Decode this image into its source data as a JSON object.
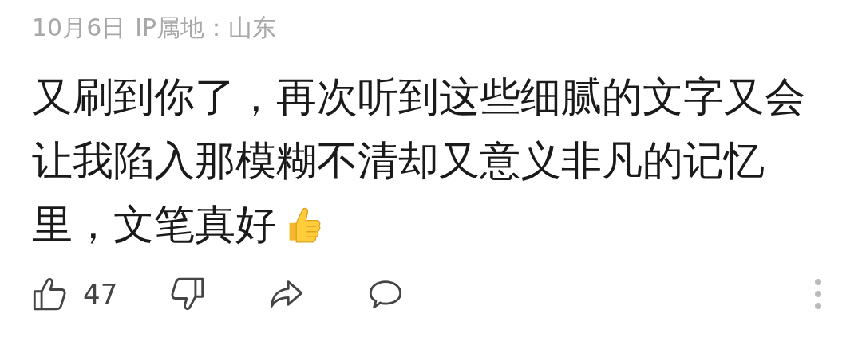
{
  "meta": {
    "date": "10月6日",
    "location": "IP属地：山东"
  },
  "comment": {
    "lines": [
      "又刷到你了，再次听到这些细腻的文字又会",
      "让我陷入那模糊不清却又意义非凡的记忆",
      "里，文笔真好"
    ]
  },
  "actions": {
    "like_count": "47"
  }
}
